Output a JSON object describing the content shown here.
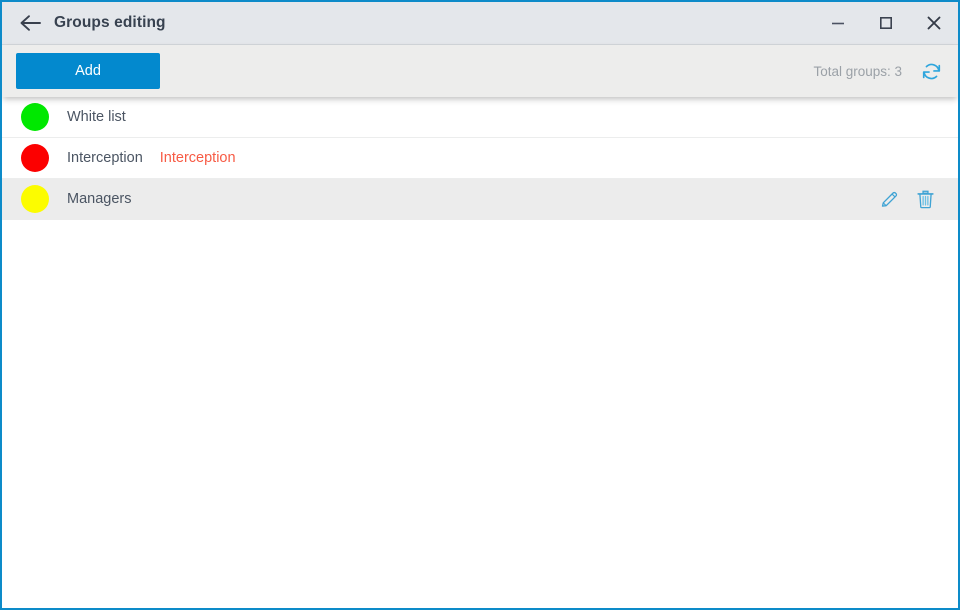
{
  "window": {
    "title": "Groups editing",
    "back_icon": "arrow-left-icon",
    "controls": {
      "minimize": "minimize-icon",
      "maximize": "maximize-icon",
      "close": "close-icon"
    },
    "border_color": "#0d8bc9",
    "titlebar_bg": "#e4e7eb"
  },
  "toolbar": {
    "add_label": "Add",
    "add_color": "#0389ce",
    "total_groups_label": "Total groups: 3",
    "refresh_icon": "refresh-icon",
    "refresh_color": "#2fa6dd",
    "bg": "#ededec"
  },
  "list": {
    "rows": [
      {
        "color": "#00e800",
        "color_name": "green",
        "name": "White list",
        "tag": "",
        "selected": false
      },
      {
        "color": "#fc0000",
        "color_name": "red",
        "name": "Interception",
        "tag": "Interception",
        "tag_color": "#f75b45",
        "selected": false
      },
      {
        "color": "#fcfc00",
        "color_name": "yellow",
        "name": "Managers",
        "tag": "",
        "selected": true,
        "actions": {
          "edit_icon": "pencil-icon",
          "delete_icon": "trash-icon",
          "icon_color": "#3fa3d4"
        }
      }
    ]
  }
}
